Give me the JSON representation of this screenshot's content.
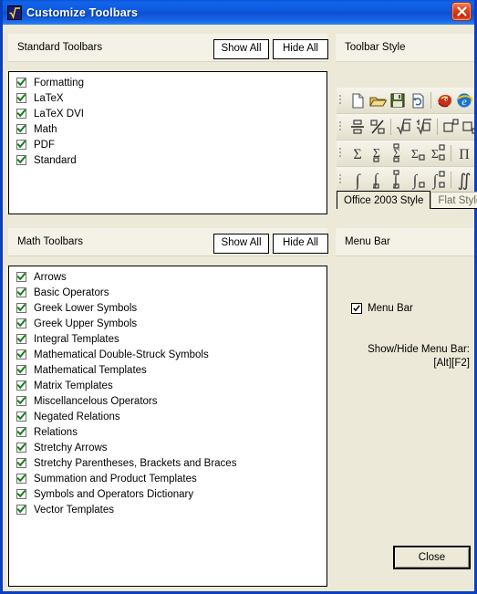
{
  "window": {
    "title": "Customize Toolbars",
    "icon": "sqrt-icon",
    "close_icon": "close-icon"
  },
  "standard_section": {
    "title": "Standard Toolbars",
    "show_all_label": "Show All",
    "hide_all_label": "Hide All",
    "items": [
      {
        "label": "Formatting",
        "checked": true
      },
      {
        "label": "LaTeX",
        "checked": true
      },
      {
        "label": "LaTeX DVI",
        "checked": true
      },
      {
        "label": "Math",
        "checked": true
      },
      {
        "label": "PDF",
        "checked": true
      },
      {
        "label": "Standard",
        "checked": true
      }
    ]
  },
  "math_section": {
    "title": "Math Toolbars",
    "show_all_label": "Show All",
    "hide_all_label": "Hide All",
    "items": [
      {
        "label": "Arrows",
        "checked": true
      },
      {
        "label": "Basic Operators",
        "checked": true
      },
      {
        "label": "Greek Lower Symbols",
        "checked": true
      },
      {
        "label": "Greek Upper Symbols",
        "checked": true
      },
      {
        "label": "Integral Templates",
        "checked": true
      },
      {
        "label": "Mathematical  Double-Struck Symbols",
        "checked": true
      },
      {
        "label": "Mathematical Templates",
        "checked": true
      },
      {
        "label": "Matrix Templates",
        "checked": true
      },
      {
        "label": "Miscellancelous Operators",
        "checked": true
      },
      {
        "label": "Negated Relations",
        "checked": true
      },
      {
        "label": "Relations",
        "checked": true
      },
      {
        "label": "Stretchy Arrows",
        "checked": true
      },
      {
        "label": "Stretchy Parentheses, Brackets and Braces",
        "checked": true
      },
      {
        "label": "Summation and Product Templates",
        "checked": true
      },
      {
        "label": "Symbols and Operators Dictionary",
        "checked": true
      },
      {
        "label": "Vector Templates",
        "checked": true
      }
    ]
  },
  "toolbar_style": {
    "title": "Toolbar Style",
    "tabs": [
      {
        "label": "Office 2003 Style",
        "active": true
      },
      {
        "label": "Flat Style",
        "active": false
      }
    ],
    "preview_rows": [
      {
        "icons": [
          "new-document-icon",
          "open-folder-icon",
          "save-disk-icon",
          "refresh-document-icon",
          "separator",
          "mozilla-dragon-icon",
          "internet-explorer-icon"
        ]
      },
      {
        "icons": [
          "fraction-template-icon",
          "slashed-fraction-icon",
          "separator",
          "square-root-icon",
          "nth-root-icon",
          "separator",
          "superscript-box-icon",
          "subscript-box-icon"
        ]
      },
      {
        "icons": [
          "sigma-icon",
          "sigma-lower-limit-icon",
          "sigma-both-limits-icon",
          "sigma-subscript-icon",
          "sigma-sub-sup-icon",
          "separator",
          "product-icon",
          "product-limits-icon"
        ]
      },
      {
        "icons": [
          "integral-icon",
          "integral-lower-icon",
          "integral-both-icon",
          "integral-subscript-icon",
          "integral-sub-sup-icon",
          "separator",
          "double-integral-icon",
          "double-integral-limits-icon"
        ]
      }
    ]
  },
  "menu_bar_section": {
    "title": "Menu Bar",
    "checkbox_label": "Menu Bar",
    "checkbox_checked": true,
    "hint_line_1": "Show/Hide Menu Bar:",
    "hint_line_2": "[Alt][F2]"
  },
  "footer": {
    "close_label": "Close"
  },
  "colors": {
    "title_bar_blue": "#0E5BE0",
    "window_border": "#0A3FC4",
    "dialog_face": "#ECE9D8",
    "band": "#F4F2E7",
    "check_green": "#1A7A1A",
    "close_red": "#C6280A"
  }
}
